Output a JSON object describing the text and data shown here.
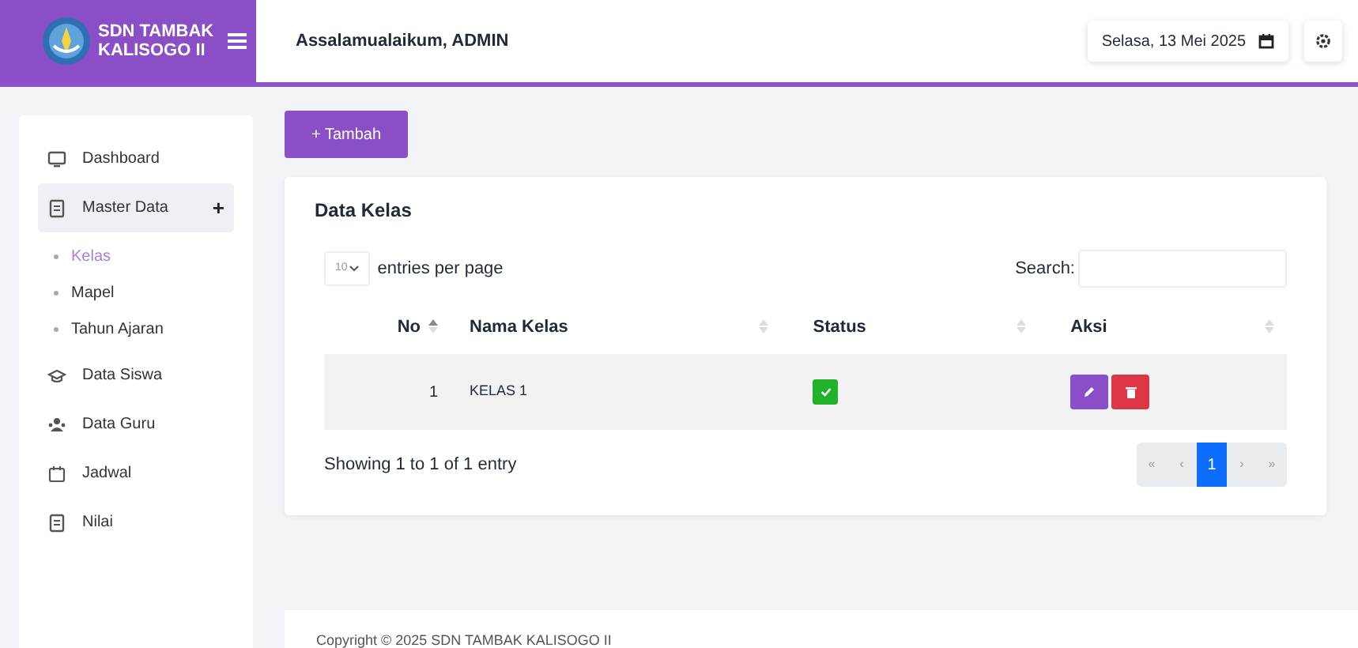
{
  "brand": {
    "name": "SDN TAMBAK KALISOGO II"
  },
  "topbar": {
    "greeting": "Assalamualaikum, ADMIN",
    "date": "Selasa, 13 Mei 2025"
  },
  "sidebar": {
    "items": [
      {
        "label": "Dashboard",
        "selected": false
      },
      {
        "label": "Master Data",
        "selected": false,
        "expanded": true,
        "toggle": "+",
        "children": [
          {
            "label": "Kelas",
            "selected": true
          },
          {
            "label": "Mapel",
            "selected": false
          },
          {
            "label": "Tahun Ajaran",
            "selected": false
          }
        ]
      },
      {
        "label": "Data Siswa",
        "selected": false
      },
      {
        "label": "Data Guru",
        "selected": false
      },
      {
        "label": "Jadwal",
        "selected": false
      },
      {
        "label": "Nilai",
        "selected": false
      }
    ]
  },
  "add_button": {
    "label": "+ Tambah"
  },
  "card": {
    "title": "Data Kelas"
  },
  "table_controls": {
    "page_size": "10",
    "page_size_label": "entries per page",
    "search_label": "Search:"
  },
  "table": {
    "columns": [
      {
        "label": "No",
        "sorted": true
      },
      {
        "label": "Nama Kelas",
        "sorted": false
      },
      {
        "label": "Status",
        "sorted": false
      },
      {
        "label": "Aksi",
        "sorted": false
      }
    ],
    "rows": [
      {
        "no": "1",
        "name": "KELAS 1",
        "active": true
      }
    ]
  },
  "info": "Showing 1 to 1 of 1 entry",
  "pagination": [
    {
      "label": "«",
      "selected": false
    },
    {
      "label": "‹",
      "selected": false
    },
    {
      "label": "1",
      "selected": true
    },
    {
      "label": "›",
      "selected": false
    },
    {
      "label": "»",
      "selected": false
    }
  ],
  "footer": "Copyright © 2025 SDN TAMBAK KALISOGO II"
}
